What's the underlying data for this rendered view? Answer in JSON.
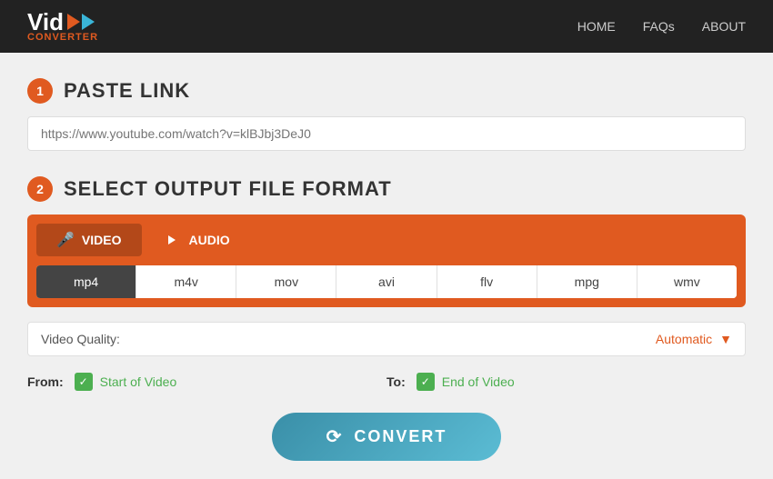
{
  "header": {
    "logo_vid": "Vid",
    "logo_converter": "CONVERTER",
    "nav": [
      {
        "label": "HOME",
        "id": "home"
      },
      {
        "label": "FAQs",
        "id": "faqs"
      },
      {
        "label": "ABOUT",
        "id": "about"
      }
    ]
  },
  "step1": {
    "badge": "1",
    "title": "PASTE LINK",
    "placeholder": "https://www.youtube.com/watch?v=klBJbj3DeJ0"
  },
  "step2": {
    "badge": "2",
    "title": "SELECT OUTPUT FILE FORMAT"
  },
  "tabs": [
    {
      "label": "VIDEO",
      "id": "video",
      "active": true
    },
    {
      "label": "AUDIO",
      "id": "audio",
      "active": false
    }
  ],
  "formats": [
    {
      "label": "mp4",
      "selected": true
    },
    {
      "label": "m4v",
      "selected": false
    },
    {
      "label": "mov",
      "selected": false
    },
    {
      "label": "avi",
      "selected": false
    },
    {
      "label": "flv",
      "selected": false
    },
    {
      "label": "mpg",
      "selected": false
    },
    {
      "label": "wmv",
      "selected": false
    }
  ],
  "quality": {
    "label": "Video Quality:",
    "value": "Automatic"
  },
  "from": {
    "label": "From:",
    "checkmark": "✓",
    "value": "Start of Video"
  },
  "to": {
    "label": "To:",
    "checkmark": "✓",
    "value": "End of Video"
  },
  "convert": {
    "label": "CONVERT",
    "icon": "⟳"
  }
}
